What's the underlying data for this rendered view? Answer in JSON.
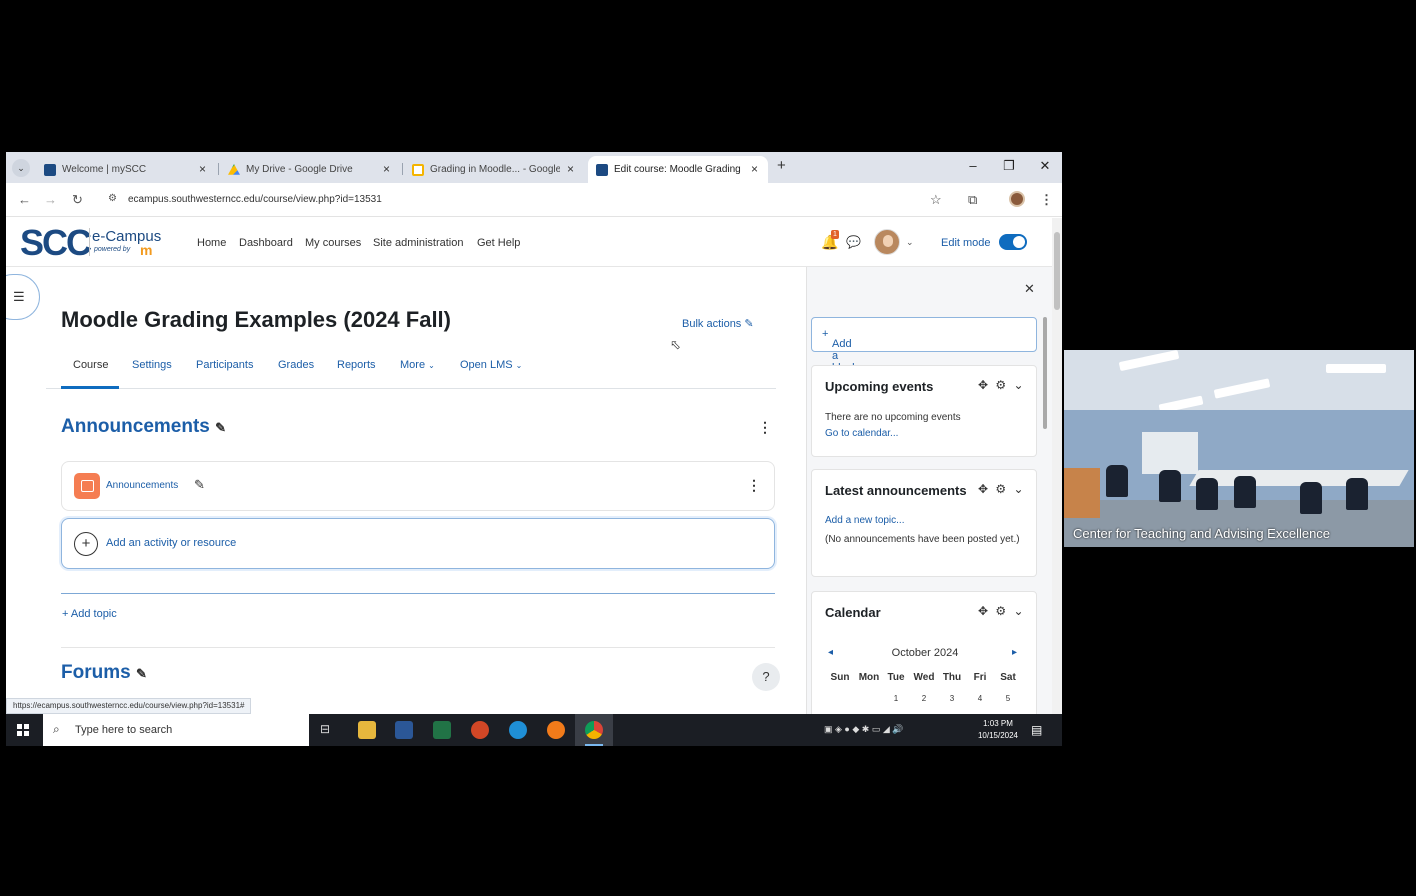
{
  "browser": {
    "tabs": [
      {
        "title": "Welcome | mySCC",
        "favicon": "scc-favicon",
        "color": "#1c4a82"
      },
      {
        "title": "My Drive - Google Drive",
        "favicon": "google-drive-favicon",
        "color": "#34a853"
      },
      {
        "title": "Grading in Moodle... - Google Slides",
        "favicon": "google-slides-favicon",
        "color": "#f4b400"
      },
      {
        "title": "Edit course: Moodle Grading Examples",
        "favicon": "moodle-favicon",
        "color": "#1c4a82"
      }
    ],
    "active_tab": 3,
    "url": "ecampus.southwesterncc.edu/course/view.php?id=13531",
    "status_url": "https://ecampus.southwesterncc.edu/course/view.php?id=13531#"
  },
  "moodle": {
    "logo": {
      "scc": "SCC",
      "brand": "e-Campus",
      "powered": "powered by"
    },
    "nav": [
      "Home",
      "Dashboard",
      "My courses",
      "Site administration",
      "Get Help"
    ],
    "notification_count": "1",
    "edit_mode_label": "Edit mode",
    "edit_mode_on": true
  },
  "course": {
    "title": "Moodle Grading Examples (2024 Fall)",
    "bulk_actions": "Bulk actions",
    "tabs": [
      "Course",
      "Settings",
      "Participants",
      "Grades",
      "Reports",
      "More",
      "Open LMS"
    ],
    "sections": [
      {
        "title": "Announcements",
        "activities": [
          {
            "name": "Announcements",
            "icon": "forum-icon"
          }
        ]
      },
      {
        "title": "Forums"
      }
    ],
    "add_activity": "Add an activity or resource",
    "add_topic": "Add topic",
    "help": "?"
  },
  "drawer": {
    "add_block": "Add a block",
    "upcoming": {
      "title": "Upcoming events",
      "text": "There are no upcoming events",
      "link": "Go to calendar..."
    },
    "announcements": {
      "title": "Latest announcements",
      "link": "Add a new topic...",
      "text": "(No announcements have been posted yet.)"
    },
    "calendar": {
      "title": "Calendar",
      "month": "October 2024",
      "days": [
        "Sun",
        "Mon",
        "Tue",
        "Wed",
        "Thu",
        "Fri",
        "Sat"
      ],
      "first_row": [
        "1",
        "2",
        "3",
        "4",
        "5"
      ]
    }
  },
  "taskbar": {
    "search_placeholder": "Type here to search",
    "time": "1:03 PM",
    "date": "10/15/2024"
  },
  "webcam": {
    "name": "Center for Teaching and Advising Excellence"
  }
}
